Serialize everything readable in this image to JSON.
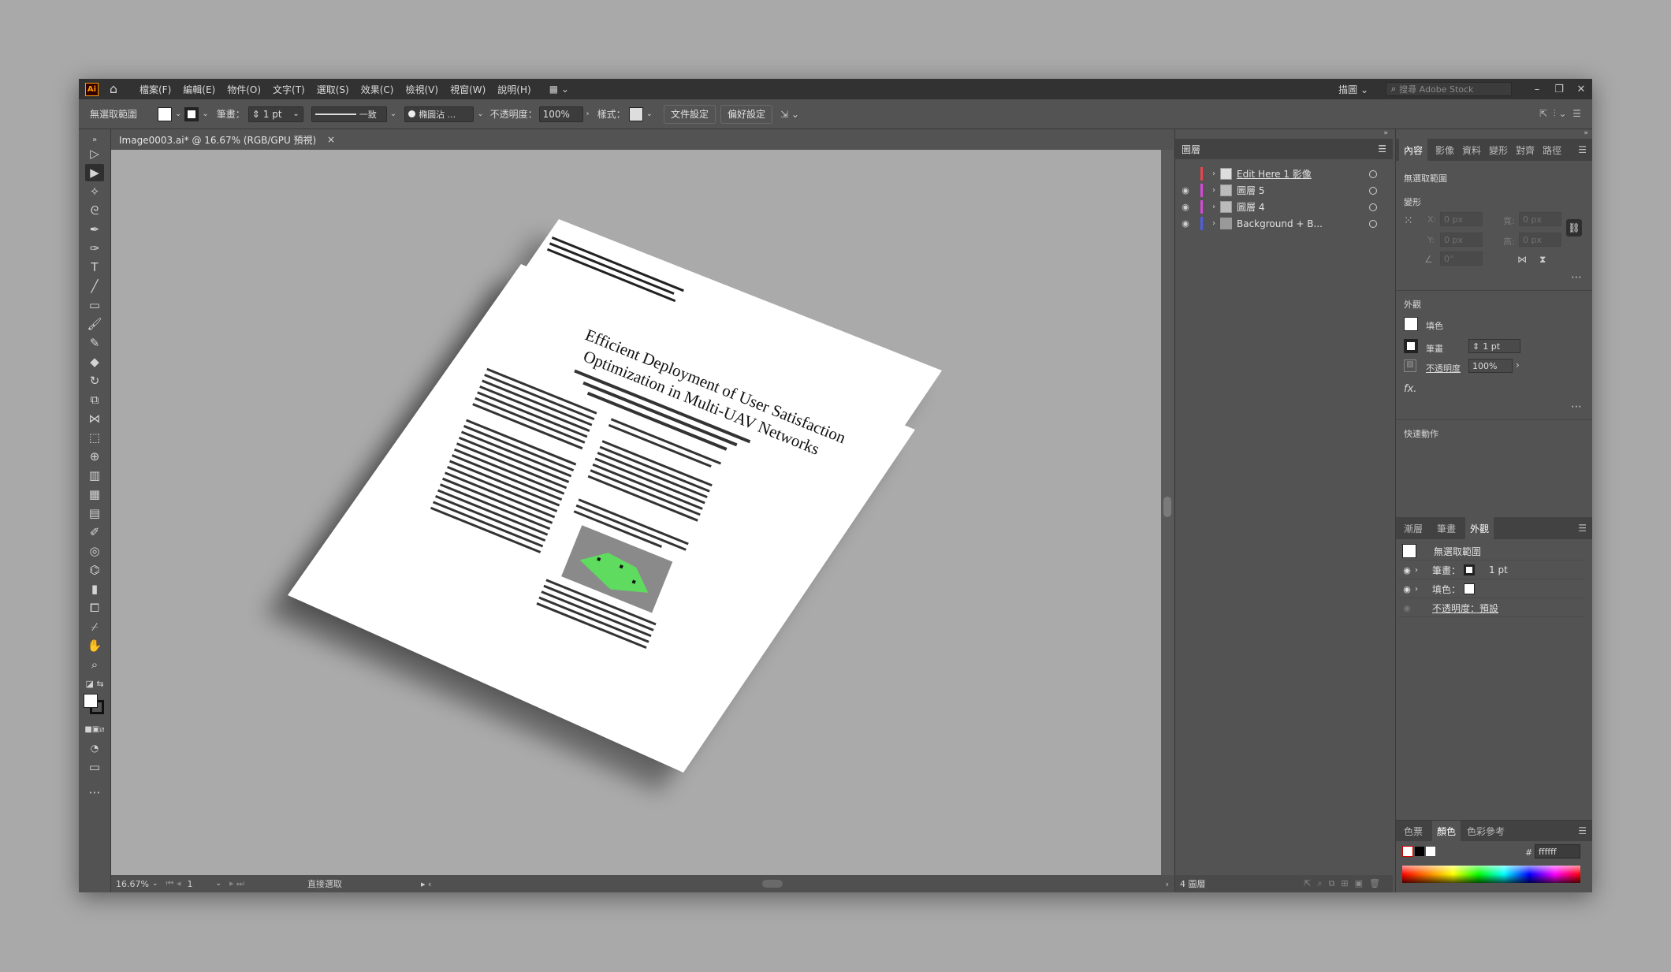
{
  "menubar": {
    "logo": "Ai",
    "menus": [
      "檔案(F)",
      "編輯(E)",
      "物件(O)",
      "文字(T)",
      "選取(S)",
      "效果(C)",
      "檢視(V)",
      "視窗(W)",
      "說明(H)"
    ],
    "workspace": "描圖",
    "search_placeholder": "搜尋 Adobe Stock"
  },
  "controlbar": {
    "selection": "無選取範圍",
    "stroke_label": "筆畫：",
    "stroke_value": "1 pt",
    "stroke_style": "一致",
    "brush": "橢圓沾 ...",
    "opacity_label": "不透明度：",
    "opacity_value": "100%",
    "style_label": "樣式：",
    "doc_settings": "文件設定",
    "preferences": "偏好設定"
  },
  "document": {
    "tab_title": "Image0003.ai* @ 16.67% (RGB/GPU 預視)",
    "zoom": "16.67%",
    "page": "1",
    "status_tool": "直接選取",
    "paper": {
      "title_line1": "Efficient Deployment of User Satisfaction",
      "title_line2": "Optimization in Multi-UAV Networks"
    }
  },
  "layers_panel": {
    "title": "圖層",
    "layers": [
      {
        "name": "Edit Here 1 影像",
        "color": "#e8464f",
        "visible": false
      },
      {
        "name": "圖層 5",
        "color": "#d44ad8",
        "visible": true
      },
      {
        "name": "圖層 4",
        "color": "#d44ad8",
        "visible": true
      },
      {
        "name": "Background + B...",
        "color": "#4f5fe0",
        "visible": true
      }
    ],
    "count": "4 圖層"
  },
  "properties_panel": {
    "tabs": [
      "內容",
      "影像",
      "資料",
      "變形",
      "對齊",
      "路徑"
    ],
    "no_selection": "無選取範圍",
    "transform_label": "變形",
    "x_label": "X:",
    "y_label": "Y:",
    "w_label": "寬:",
    "h_label": "高:",
    "x_value": "0 px",
    "y_value": "0 px",
    "w_value": "0 px",
    "h_value": "0 px",
    "angle_value": "0°",
    "appearance_label": "外觀",
    "fill_label": "填色",
    "stroke_label": "筆畫",
    "stroke_value": "1 pt",
    "opacity_label": "不透明度",
    "opacity_value": "100%",
    "fx": "fx.",
    "quick_actions": "快速動作"
  },
  "appearance_panel": {
    "tabs": [
      "漸層",
      "筆畫",
      "外觀"
    ],
    "rows": [
      {
        "label": "無選取範圍"
      },
      {
        "label": "筆畫：",
        "value": "1 pt"
      },
      {
        "label": "填色："
      },
      {
        "label": "不透明度：預設"
      }
    ]
  },
  "color_panel": {
    "tabs": [
      "色票",
      "顏色",
      "色彩參考"
    ],
    "hex_label": "#",
    "hex_value": "ffffff"
  }
}
